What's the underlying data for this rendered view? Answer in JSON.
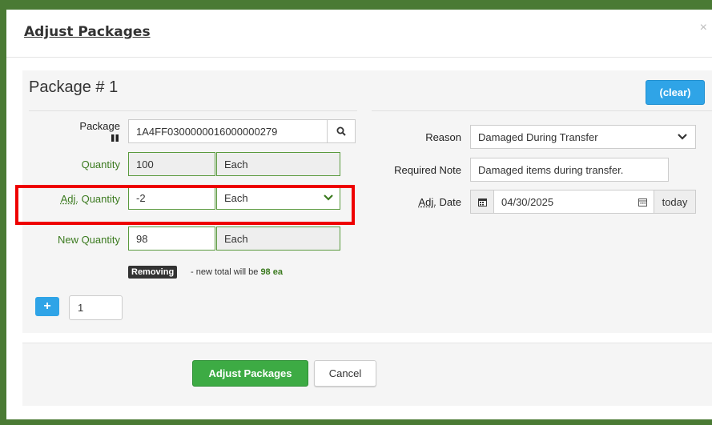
{
  "modal": {
    "title": "Adjust Packages",
    "close": "×"
  },
  "package": {
    "title": "Package # 1",
    "clear_label": "(clear)",
    "package_label": "Package",
    "package_id": "1A4FF0300000016000000279",
    "quantity_label": "Quantity",
    "quantity_value": "100",
    "quantity_unit": "Each",
    "adj_quantity_label_prefix": "Adj.",
    "adj_quantity_label_suffix": " Quantity",
    "adj_quantity_value": "-2",
    "adj_quantity_unit": "Each",
    "new_quantity_label": "New Quantity",
    "new_quantity_value": "98",
    "new_quantity_unit": "Each",
    "removing_badge": "Removing",
    "note_prefix": " - new total will be ",
    "note_total": "98 ea",
    "reason_label": "Reason",
    "reason_value": "Damaged During Transfer",
    "required_note_label": "Required Note",
    "required_note_value": "Damaged items during transfer.",
    "adj_date_label_prefix": "Adj.",
    "adj_date_label_suffix": " Date",
    "adj_date_value": "04/30/2025",
    "today_label": "today"
  },
  "add_row": {
    "count": "1"
  },
  "footer": {
    "adjust_label": "Adjust Packages",
    "cancel_label": "Cancel"
  },
  "colors": {
    "accent_blue": "#2fa4e7",
    "success_green": "#3dab44",
    "label_green": "#3b7a1f",
    "highlight_red": "#e00000"
  }
}
